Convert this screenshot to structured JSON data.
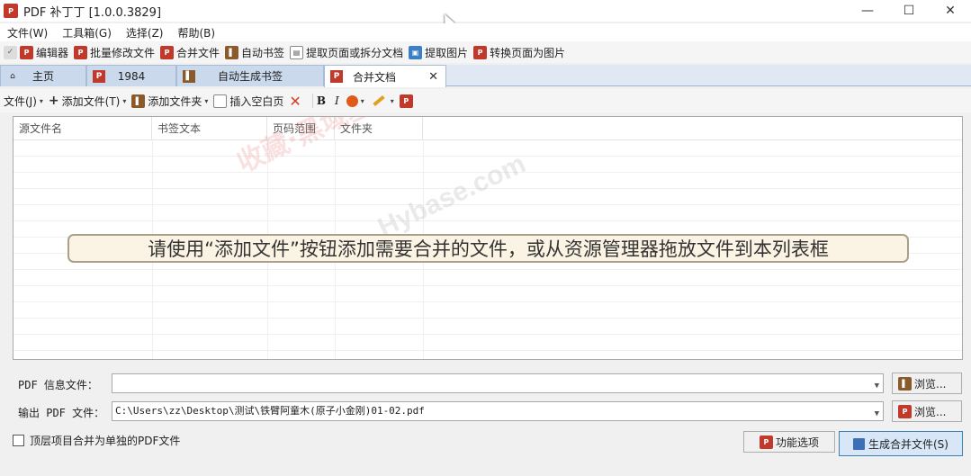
{
  "window": {
    "title": "PDF 补丁丁 [1.0.0.3829]",
    "icon": "pdf-app-icon",
    "controls": [
      "—",
      "☐",
      "✕"
    ]
  },
  "menu": [
    "文件(W)",
    "工具箱(G)",
    "选择(Z)",
    "帮助(B)"
  ],
  "quickbar": [
    {
      "label": "编辑器",
      "icon": "pdf-edit-icon"
    },
    {
      "label": "批量修改文件",
      "icon": "pdf-batch-icon"
    },
    {
      "label": "合并文件",
      "icon": "pdf-merge-icon"
    },
    {
      "label": "自动书签",
      "icon": "bookmark-icon"
    },
    {
      "label": "提取页面或拆分文档",
      "icon": "extract-page-icon"
    },
    {
      "label": "提取图片",
      "icon": "extract-image-icon"
    },
    {
      "label": "转换页面为图片",
      "icon": "pdf-to-image-icon"
    }
  ],
  "tabs": [
    {
      "label": "主页",
      "icon": "home-icon"
    },
    {
      "label": "1984",
      "icon": "pdf-icon"
    },
    {
      "label": "自动生成书签",
      "icon": "bookmark-icon"
    },
    {
      "label": "合并文档",
      "icon": "pdf-merge-icon",
      "active": true
    }
  ],
  "tab_close": "✕",
  "toolbar": {
    "file": "文件(J)",
    "add_file": "添加文件(T)",
    "add_folder": "添加文件夹",
    "insert_blank": "插入空白页",
    "bold": "B",
    "italic": "I",
    "arrow": "▾"
  },
  "list": {
    "columns": [
      "源文件名",
      "书签文本",
      "页码范围",
      "文件夹"
    ],
    "hint": "请使用“添加文件”按钮添加需要合并的文件，或从资源管理器拖放文件到本列表框",
    "watermark_cn": "收藏·黑域基地",
    "watermark_en": "Hybase.com"
  },
  "info_file": {
    "label": "PDF 信息文件：",
    "value": "",
    "browse": "浏览..."
  },
  "output_file": {
    "label": "输出 PDF 文件：",
    "value": "C:\\Users\\zz\\Desktop\\测试\\铁臂阿童木(原子小金刚)01-02.pdf",
    "browse": "浏览..."
  },
  "merge_toplevel": "顶层项目合并为单独的PDF文件",
  "options_button": "功能选项",
  "generate_button": "生成合并文件(S)",
  "colors": {
    "tab_bg": "#cad9ec",
    "primary_btn": "#d7e7f8",
    "accent_red": "#c0392b"
  }
}
